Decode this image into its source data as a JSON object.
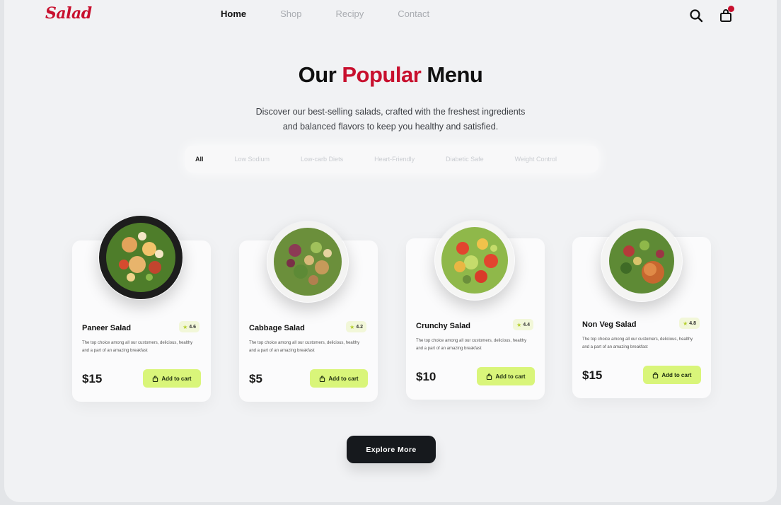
{
  "nav": {
    "logo": "Salad",
    "links": [
      "Home",
      "Shop",
      "Recipy",
      "Contact"
    ],
    "active_link": "Home",
    "icons": [
      "search-icon",
      "cart-icon"
    ],
    "cart_badge_color": "#c8102e"
  },
  "hero": {
    "title_before": "Our ",
    "title_accent": "Popular",
    "title_after": " Menu",
    "subtitle_line1": "Discover our best-selling salads, crafted with the freshest ingredients",
    "subtitle_line2": "and balanced flavors to keep you healthy and satisfied."
  },
  "filters": {
    "active": "All",
    "tabs": [
      "All",
      "Low Sodium",
      "Low-carb Diets",
      "Heart-Friendly",
      "Diabetic Safe",
      "Weight Control"
    ]
  },
  "cards": [
    {
      "name": "Paneer Salad",
      "rating": "4.6",
      "description": "The top choice among all our customers, delicious, healthy and a part of an amazing breakfast",
      "price": "$15",
      "cta": "Add to cart"
    },
    {
      "name": "Cabbage Salad",
      "rating": "4.2",
      "description": "The top choice among all our customers, delicious, healthy and a part of an amazing breakfast",
      "price": "$5",
      "cta": "Add to cart"
    },
    {
      "name": "Crunchy Salad",
      "rating": "4.4",
      "description": "The top choice among all our customers, delicious, healthy and a part of an amazing breakfast",
      "price": "$10",
      "cta": "Add to cart"
    },
    {
      "name": "Non Veg Salad",
      "rating": "4.8",
      "description": "The top choice among all our customers, delicious, healthy and a part of an amazing breakfast",
      "price": "$15",
      "cta": "Add to cart"
    }
  ],
  "explore_label": "Explore More",
  "colors": {
    "accent": "#c8102e",
    "cta_green": "#d9f57a",
    "dark_button": "#16191d",
    "background": "#f1f2f4"
  }
}
